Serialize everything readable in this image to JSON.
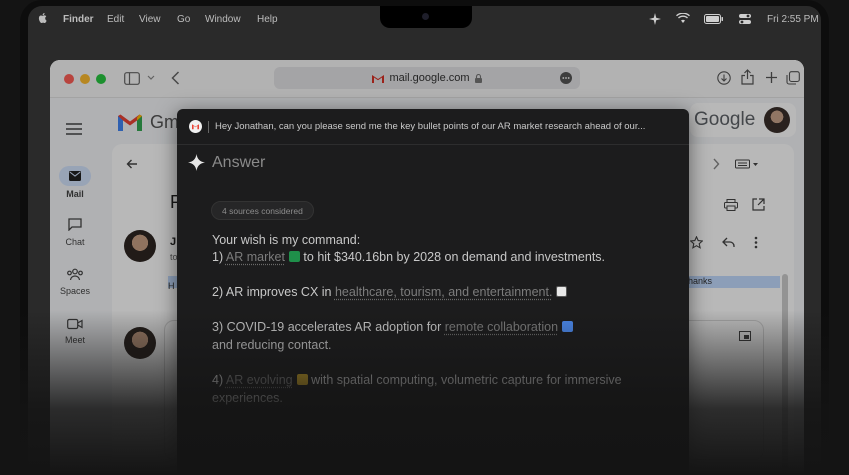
{
  "menubar": {
    "items": [
      "Finder",
      "Edit",
      "View",
      "Go",
      "Window",
      "Help"
    ],
    "clock": "Fri 2:55 PM"
  },
  "browser": {
    "url": "mail.google.com"
  },
  "gmail": {
    "title_partial": "Gm",
    "google_logo": "Google",
    "nav": [
      {
        "label": "Mail",
        "icon": "mail-icon"
      },
      {
        "label": "Chat",
        "icon": "chat-icon"
      },
      {
        "label": "Spaces",
        "icon": "spaces-icon"
      },
      {
        "label": "Meet",
        "icon": "meet-icon"
      }
    ],
    "subject_partial": "P",
    "sender_partial": "J",
    "to_partial": "to",
    "snippet_partial": "H",
    "highlight_right": "hanks"
  },
  "answer": {
    "prompt": "Hey Jonathan, can you please send me the key bullet points of our AR market research ahead of our...",
    "title": "Answer",
    "sources": "4 sources considered",
    "intro": "Your wish is my command:",
    "p1_prefix": "1) ",
    "p1_link": "AR market",
    "p1_rest": " to hit $340.16bn by 2028 on demand and investments.",
    "p2_prefix": "2) AR improves CX in ",
    "p2_link": "healthcare, tourism, and entertainment.",
    "p3_prefix": "3) COVID-19 accelerates AR adoption for ",
    "p3_link": "remote collaboration",
    "p3_rest": "and reducing contact.",
    "p4_prefix": "4) ",
    "p4_link": "AR evolving",
    "p4_rest": " with spatial computing, volumetric capture for immersive",
    "p4_rest2": "experiences."
  },
  "colors": {
    "panel_bg": "#1c1c1d",
    "sheets_green": "#1f8f4a",
    "notion_gray": "#8a8a8a",
    "doc_blue": "#4a86e8",
    "slides_yellow": "#c9a227"
  }
}
